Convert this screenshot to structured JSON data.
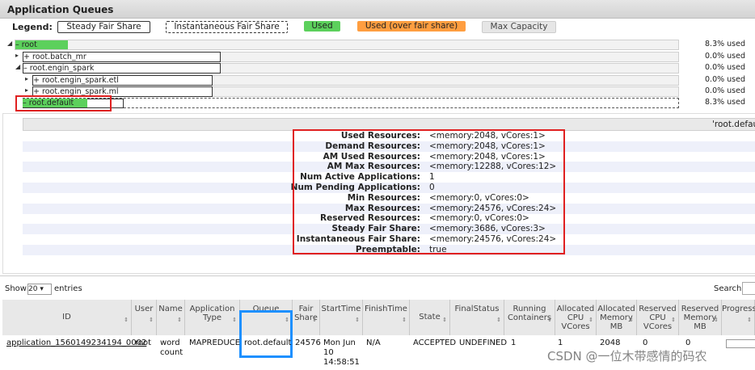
{
  "header": {
    "title": "Application Queues"
  },
  "legend": {
    "label": "Legend:",
    "items": [
      {
        "label": "Steady Fair Share",
        "style": "solid"
      },
      {
        "label": "Instantaneous Fair Share",
        "style": "dashed"
      },
      {
        "label": "Used",
        "color": "#5cd05c"
      },
      {
        "label": "Used (over fair share)",
        "color": "#ff9e40"
      },
      {
        "label": "Max Capacity",
        "color": "#e6e6e6"
      }
    ]
  },
  "queues": [
    {
      "name": "root",
      "expand": "–",
      "used": "8.3% used",
      "used_fraction": 0.083
    },
    {
      "name": "root.batch_mr",
      "expand": "+",
      "used": "0.0% used",
      "used_fraction": 0
    },
    {
      "name": "root.engin_spark",
      "expand": "–",
      "used": "0.0% used",
      "used_fraction": 0
    },
    {
      "name": "root.engin_spark.etl",
      "expand": "+",
      "used": "0.0% used",
      "used_fraction": 0
    },
    {
      "name": "root.engin_spark.ml",
      "expand": "+",
      "used": "0.0% used",
      "used_fraction": 0
    },
    {
      "name": "root.default",
      "expand": "–",
      "used": "8.3% used",
      "used_fraction": 0.083
    }
  ],
  "detail": {
    "header": "'root.defau",
    "rows": [
      {
        "label": "Used Resources:",
        "value": "<memory:2048, vCores:1>"
      },
      {
        "label": "Demand Resources:",
        "value": "<memory:2048, vCores:1>"
      },
      {
        "label": "AM Used Resources:",
        "value": "<memory:2048, vCores:1>"
      },
      {
        "label": "AM Max Resources:",
        "value": "<memory:12288, vCores:12>"
      },
      {
        "label": "Num Active Applications:",
        "value": "1"
      },
      {
        "label": "Num Pending Applications:",
        "value": "0"
      },
      {
        "label": "Min Resources:",
        "value": "<memory:0, vCores:0>"
      },
      {
        "label": "Max Resources:",
        "value": "<memory:24576, vCores:24>"
      },
      {
        "label": "Reserved Resources:",
        "value": "<memory:0, vCores:0>"
      },
      {
        "label": "Steady Fair Share:",
        "value": "<memory:3686, vCores:3>"
      },
      {
        "label": "Instantaneous Fair Share:",
        "value": "<memory:24576, vCores:24>"
      },
      {
        "label": "Preemptable:",
        "value": "true"
      }
    ]
  },
  "table": {
    "show_label": "Show",
    "show_value": "20",
    "entries_label": "entries",
    "search_label": "Search:",
    "columns": [
      "ID",
      "User",
      "Name",
      "Application Type",
      "Queue",
      "Fair Share",
      "StartTime",
      "FinishTime",
      "State",
      "FinalStatus",
      "Running Containers",
      "Allocated CPU VCores",
      "Allocated Memory MB",
      "Reserved CPU VCores",
      "Reserved Memory MB",
      "Progress"
    ],
    "rows": [
      {
        "id": "application_1560149234194_0002",
        "user": "root",
        "name": "word count",
        "type": "MAPREDUCE",
        "queue": "root.default",
        "fair_share": "24576",
        "start": "Mon Jun 10 14:58:51",
        "finish": "N/A",
        "state": "ACCEPTED",
        "final_status": "UNDEFINED",
        "running": "1",
        "alloc_cpu": "1",
        "alloc_mem": "2048",
        "res_cpu": "0",
        "res_mem": "0"
      }
    ]
  },
  "watermark": "CSDN @一位木带感情的码农"
}
